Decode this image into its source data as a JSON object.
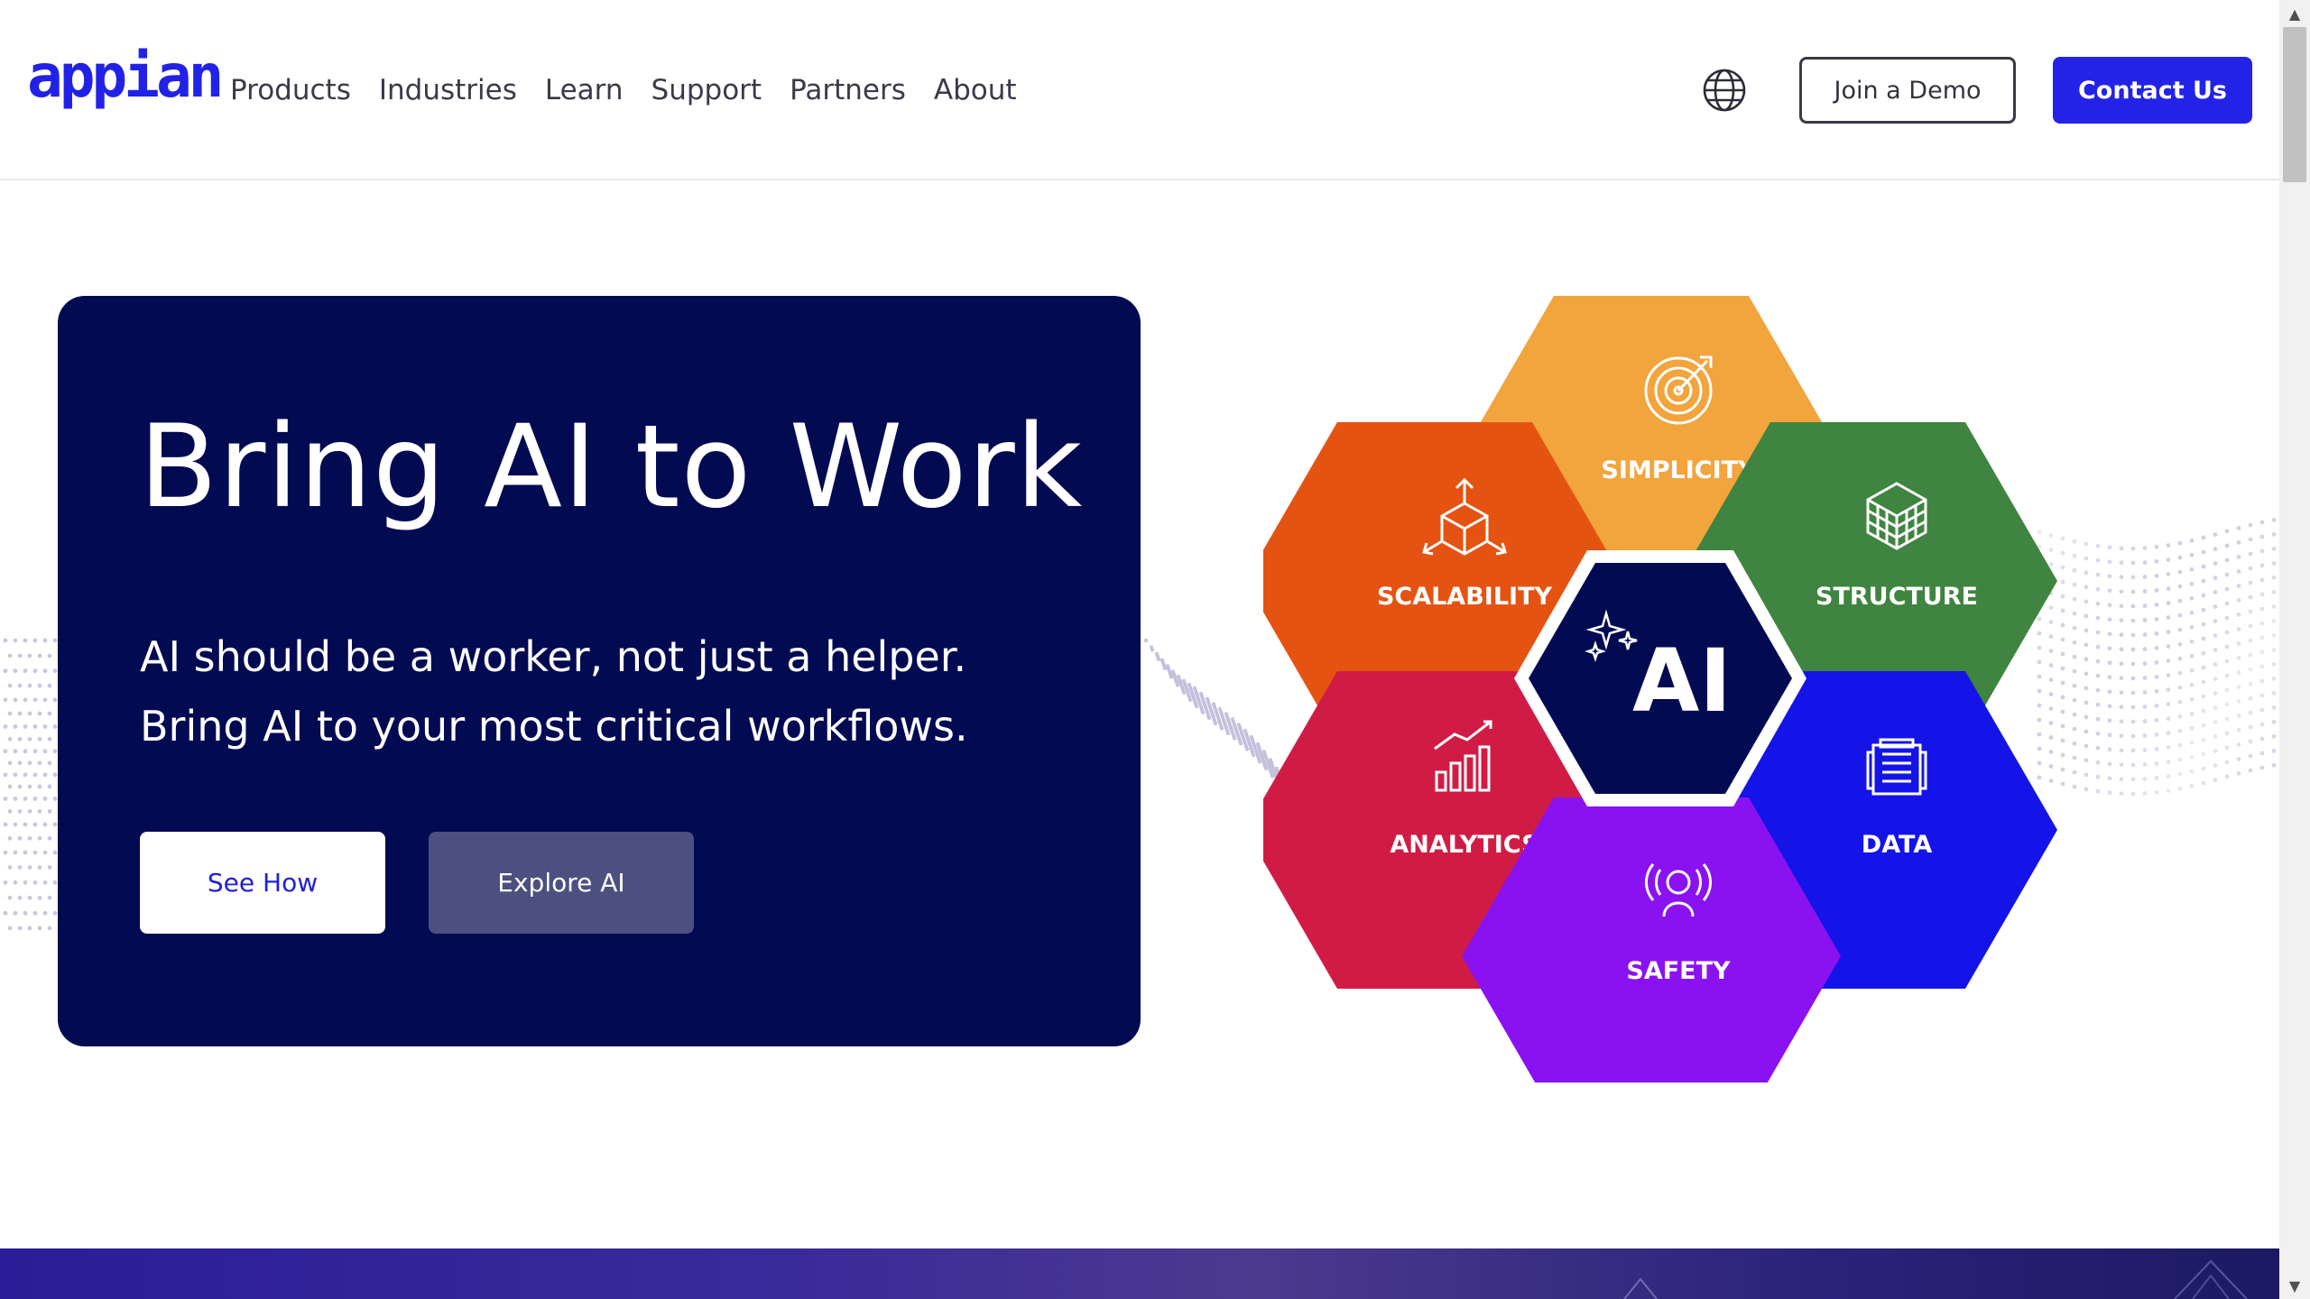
{
  "brand": {
    "logo_text": "appian",
    "color": "#2222e6"
  },
  "nav": {
    "items": [
      "Products",
      "Industries",
      "Learn",
      "Support",
      "Partners",
      "About"
    ]
  },
  "header": {
    "language_icon": "globe-icon",
    "demo_button": "Join a Demo",
    "contact_button": "Contact Us"
  },
  "hero": {
    "title": "Bring AI to Work",
    "subtitle_lines": [
      "AI should be a worker, not just a helper.",
      "Bring AI to your most critical workflows."
    ],
    "primary_button": "See How",
    "secondary_button": "Explore AI",
    "card_color": "#020a52"
  },
  "hexagons": {
    "center": {
      "label": "AI",
      "icon": "sparkles-icon",
      "color": "#020a52"
    },
    "items": [
      {
        "key": "simplicity",
        "label": "SIMPLICITY",
        "icon": "target-icon",
        "color": "#f2a43d"
      },
      {
        "key": "scalability",
        "label": "SCALABILITY",
        "icon": "cube-arrows-icon",
        "color": "#e55312"
      },
      {
        "key": "structure",
        "label": "STRUCTURE",
        "icon": "grid-cube-icon",
        "color": "#3f8440"
      },
      {
        "key": "analytics",
        "label": "ANALYTICS",
        "icon": "bar-chart-icon",
        "color": "#d01c45"
      },
      {
        "key": "data",
        "label": "DATA",
        "icon": "server-icon",
        "color": "#1414e8"
      },
      {
        "key": "safety",
        "label": "SAFETY",
        "icon": "person-signal-icon",
        "color": "#8a12f0"
      }
    ]
  },
  "scrollbar": {
    "up_icon": "▲",
    "down_icon": "▼"
  }
}
